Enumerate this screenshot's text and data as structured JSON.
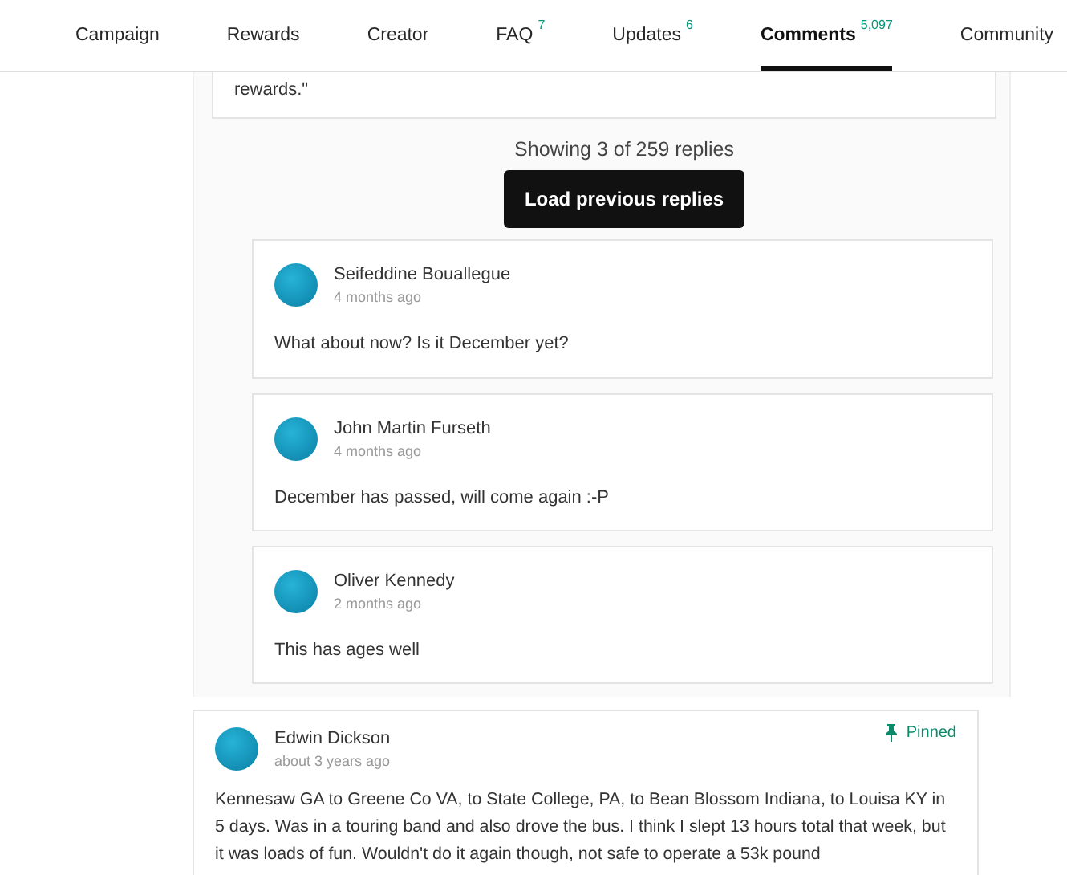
{
  "tabs": [
    {
      "label": "Campaign",
      "selected": false
    },
    {
      "label": "Rewards",
      "selected": false
    },
    {
      "label": "Creator",
      "selected": false
    },
    {
      "label": "FAQ",
      "count": "7",
      "selected": false
    },
    {
      "label": "Updates",
      "count": "6",
      "selected": false
    },
    {
      "label": "Comments",
      "count": "5,097",
      "selected": true
    },
    {
      "label": "Community",
      "selected": false
    }
  ],
  "parent_comment_tail": "rewards.\"",
  "replies_status": "Showing 3 of 259 replies",
  "load_button": "Load previous replies",
  "replies": [
    {
      "author": "Seifeddine Bouallegue",
      "time": "4 months ago",
      "text": "What about now? Is it December yet?"
    },
    {
      "author": "John Martin Furseth",
      "time": "4 months ago",
      "text": "December has passed, will come again :-P"
    },
    {
      "author": "Oliver Kennedy",
      "time": "2 months ago",
      "text": "This has ages well"
    }
  ],
  "pinned_comment": {
    "author": "Edwin Dickson",
    "time": "about 3 years ago",
    "pinned": true,
    "pin_label": "Pinned",
    "text": "Kennesaw GA to Greene Co VA, to State College, PA, to Bean Blossom Indiana, to Louisa KY in 5 days. Was in a touring band and also drove the bus. I think I slept 13 hours total that week, but it was loads of fun. Wouldn't do it again though, not safe to operate a 53k pound"
  }
}
